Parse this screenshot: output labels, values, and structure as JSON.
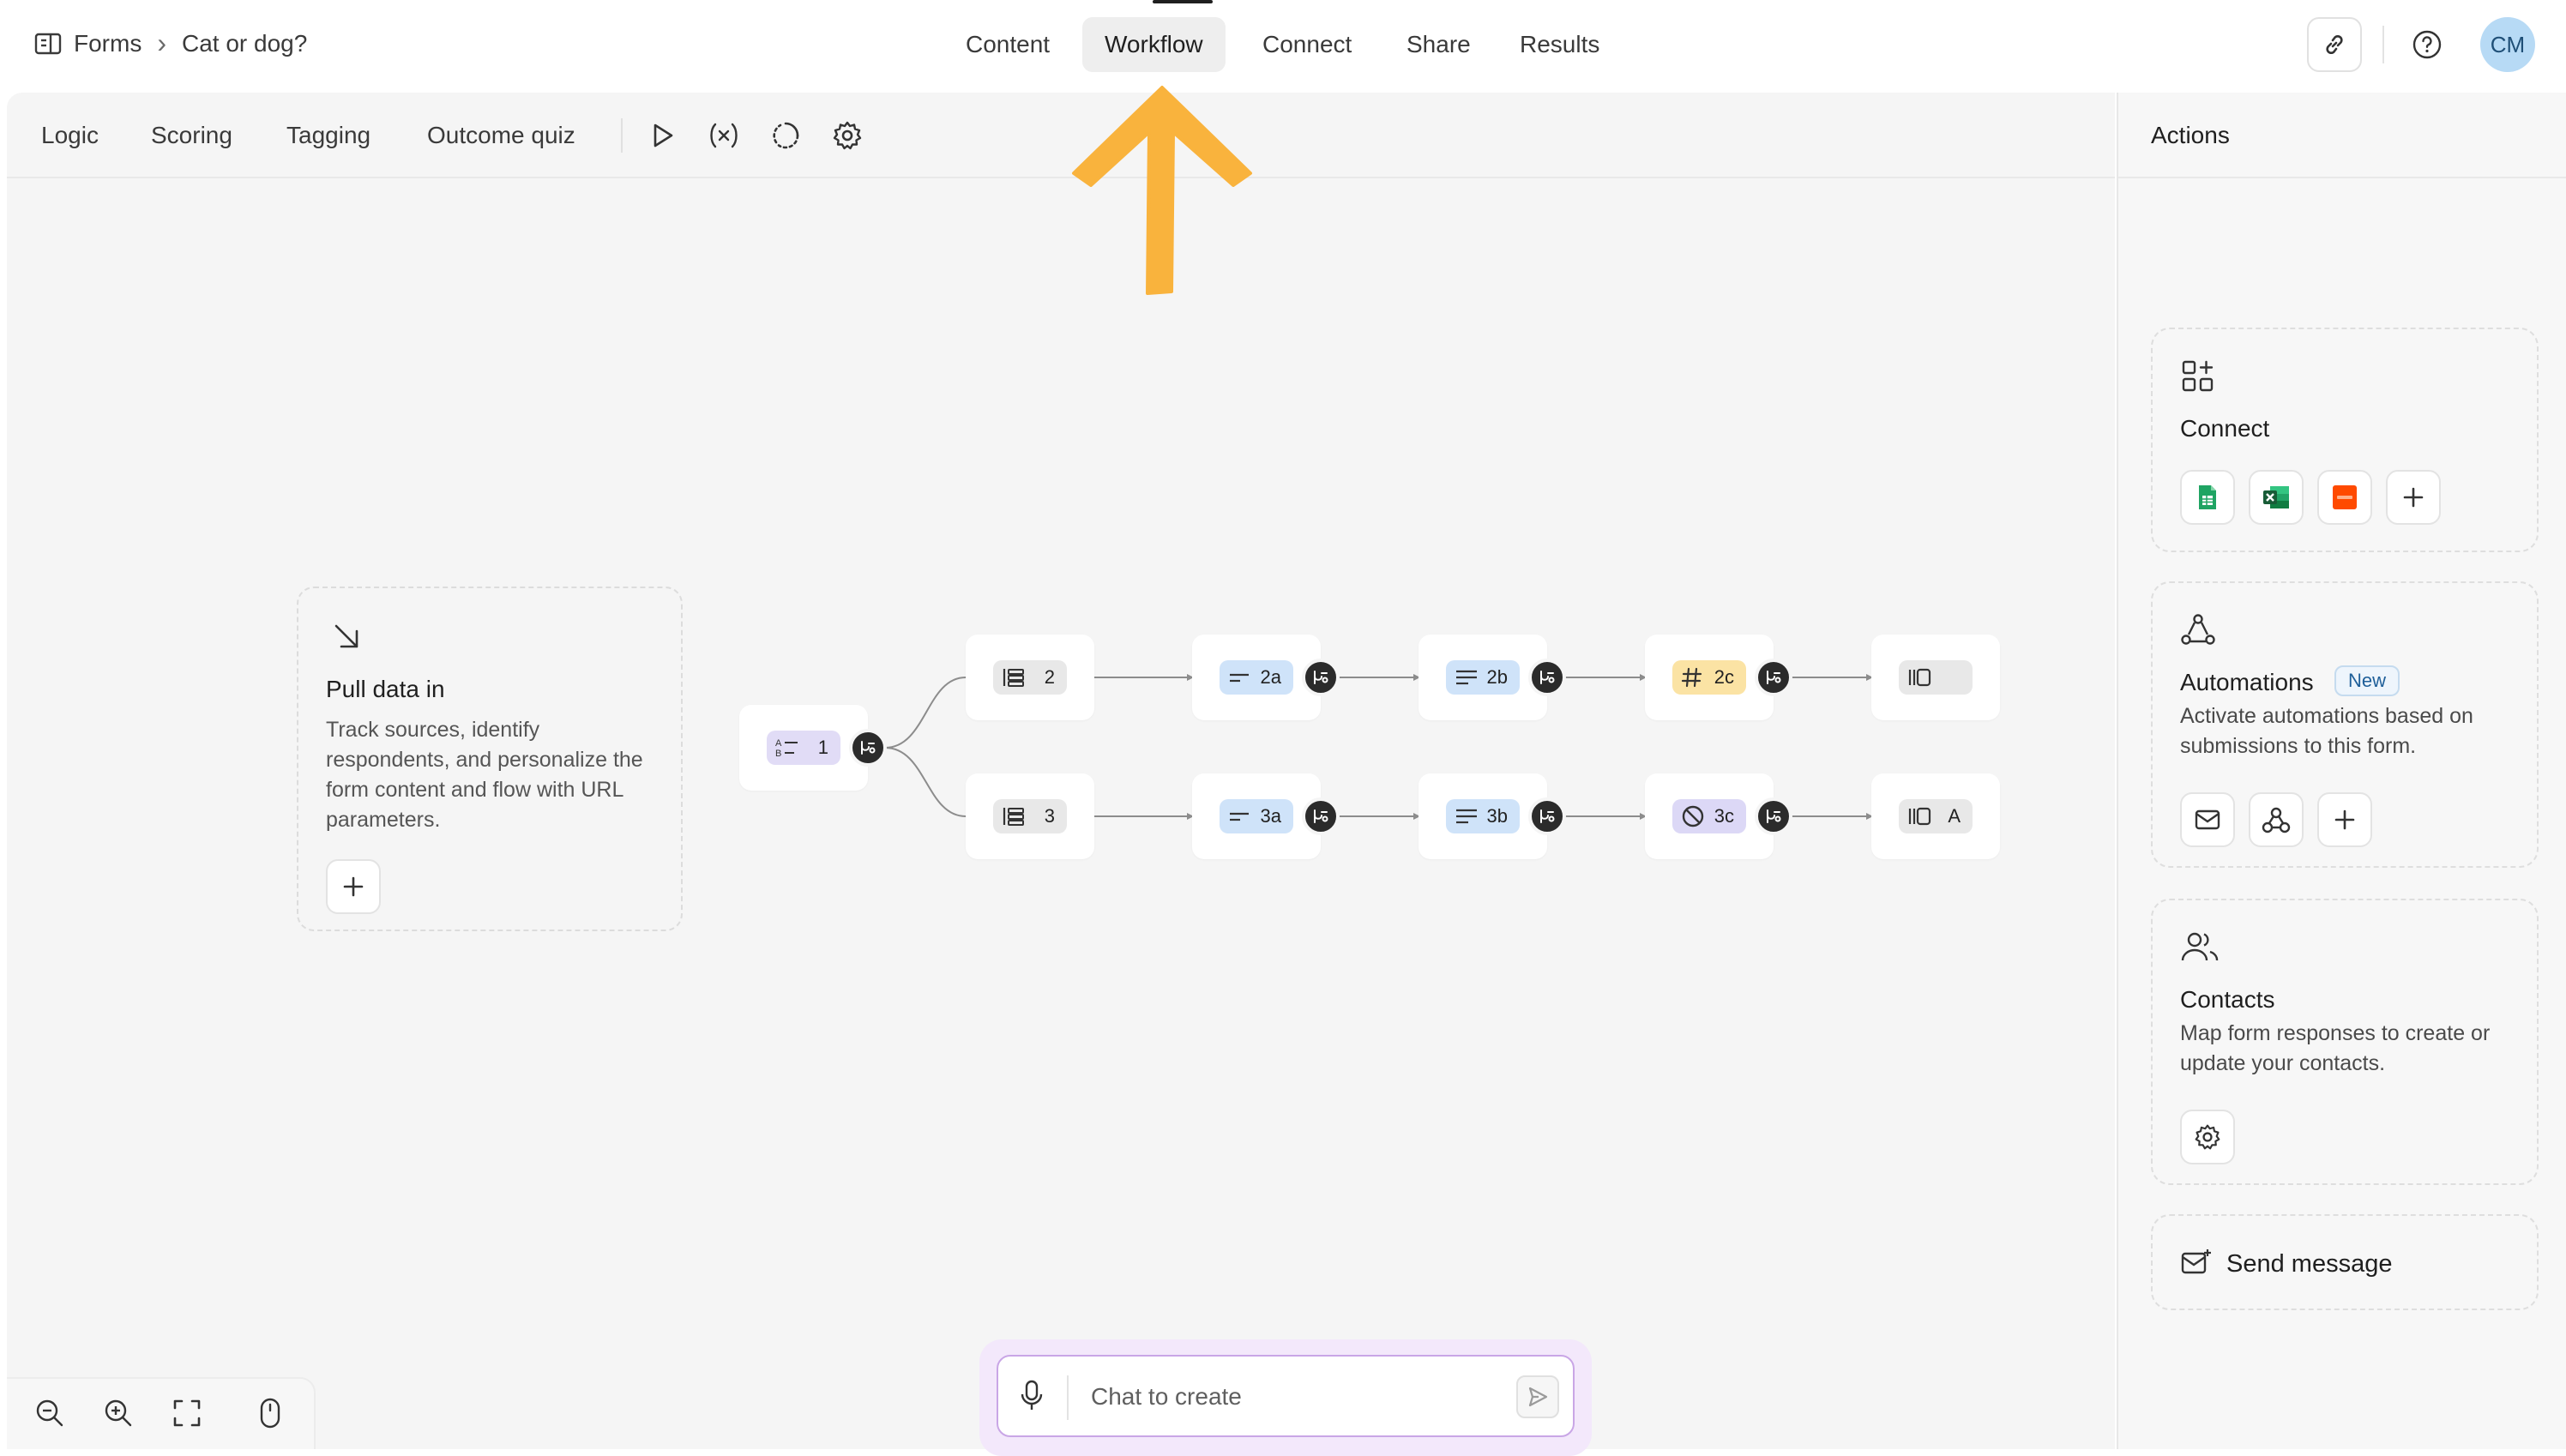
{
  "breadcrumb": {
    "root": "Forms",
    "separator": "›",
    "current": "Cat or dog?"
  },
  "top_tabs": [
    {
      "label": "Content"
    },
    {
      "label": "Workflow",
      "active": true
    },
    {
      "label": "Connect"
    },
    {
      "label": "Share"
    },
    {
      "label": "Results"
    }
  ],
  "user": {
    "initials": "CM",
    "avatar_color": "#b7daf5"
  },
  "sub_tabs": [
    {
      "label": "Logic"
    },
    {
      "label": "Scoring"
    },
    {
      "label": "Tagging"
    },
    {
      "label": "Outcome quiz"
    }
  ],
  "sub_icons": [
    "play-icon",
    "variable-icon",
    "loading-icon",
    "settings-gear-icon"
  ],
  "pull_data": {
    "title": "Pull data in",
    "description": "Track sources, identify respondents, and personalize the form content and flow with URL parameters."
  },
  "flow_nodes": [
    {
      "id": "1",
      "icon": "choice-icon",
      "color": "#e1dcf6"
    },
    {
      "id": "2",
      "icon": "list-icon",
      "color": "#e8e8e8"
    },
    {
      "id": "2a",
      "icon": "short-text-icon",
      "color": "#cfe3f9"
    },
    {
      "id": "2b",
      "icon": "long-text-icon",
      "color": "#cfe3f9"
    },
    {
      "id": "2c",
      "icon": "hash-icon",
      "color": "#fbe3a4"
    },
    {
      "id": "",
      "icon": "ending-icon",
      "color": "#e8e8e8"
    },
    {
      "id": "3",
      "icon": "list-icon",
      "color": "#e8e8e8"
    },
    {
      "id": "3a",
      "icon": "short-text-icon",
      "color": "#cfe3f9"
    },
    {
      "id": "3b",
      "icon": "long-text-icon",
      "color": "#cfe3f9"
    },
    {
      "id": "3c",
      "icon": "blocked-icon",
      "color": "#dcd8f6"
    },
    {
      "id": "A",
      "icon": "ending-icon",
      "color": "#e8e8e8"
    }
  ],
  "chat": {
    "placeholder": "Chat to create"
  },
  "actions": {
    "title": "Actions",
    "connect": {
      "title": "Connect",
      "apps": [
        "google-sheets-icon",
        "excel-icon",
        "zapier-icon",
        "add-icon"
      ]
    },
    "automations": {
      "title": "Automations",
      "badge": "New",
      "description": "Activate automations based on submissions to this form."
    },
    "contacts": {
      "title": "Contacts",
      "description": "Map form responses to create or update your contacts."
    },
    "send_message": {
      "label": "Send message"
    }
  },
  "colors": {
    "accent_arrow": "#f9b33d",
    "branch_dot": "#2b2b2b",
    "canvas_bg": "#f5f5f5"
  }
}
